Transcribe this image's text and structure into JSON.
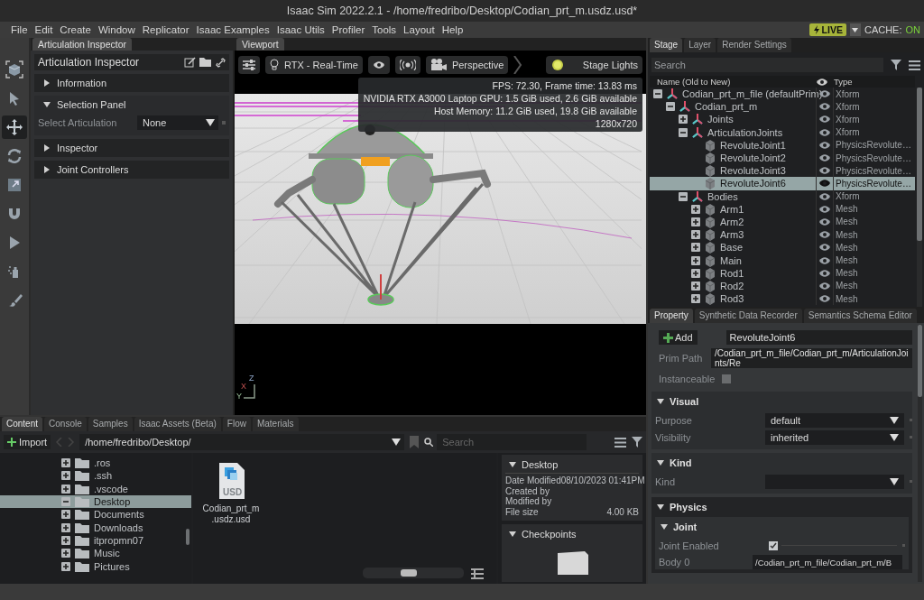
{
  "window": {
    "title": "Isaac Sim 2022.2.1 - /home/fredribo/Desktop/Codian_prt_m.usdz.usd*"
  },
  "menu": [
    "File",
    "Edit",
    "Create",
    "Window",
    "Replicator",
    "Isaac Examples",
    "Isaac Utils",
    "Profiler",
    "Tools",
    "Layout",
    "Help"
  ],
  "live": {
    "label": "LIVE",
    "on": true
  },
  "cache": {
    "label": "CACHE:",
    "status": "ON",
    "on": true
  },
  "toolbar": [
    {
      "kind": "cube",
      "selected": false
    },
    {
      "kind": "pointer",
      "selected": false
    },
    {
      "kind": "move",
      "selected": true
    },
    {
      "kind": "rotate",
      "selected": false
    },
    {
      "kind": "scale",
      "selected": false
    },
    {
      "kind": "magnet",
      "selected": false
    },
    {
      "kind": "play",
      "selected": false
    },
    {
      "kind": "bottle",
      "selected": false
    },
    {
      "kind": "brush",
      "selected": false
    }
  ],
  "articulation_inspector": {
    "tab": "Articulation Inspector",
    "title": "Articulation Inspector",
    "sections": [
      {
        "label": "Information",
        "expanded": false
      },
      {
        "label": "Selection Panel",
        "expanded": true,
        "fields": [
          {
            "label": "Select Articulation",
            "value": "None"
          }
        ]
      },
      {
        "label": "Inspector",
        "expanded": false
      },
      {
        "label": "Joint Controllers",
        "expanded": false
      }
    ]
  },
  "viewport": {
    "tab": "Viewport",
    "renderer": "RTX - Real-Time",
    "camera": "Perspective",
    "lights": "Stage Lights",
    "stats": [
      "FPS: 72.30, Frame time: 13.83 ms",
      "NVIDIA RTX A3000 Laptop GPU: 1.5 GiB used, 2.6 GiB available",
      "Host Memory: 11.2 GiB used, 19.8 GiB available",
      "1280x720"
    ],
    "axes": {
      "z": "Z",
      "x": "X",
      "y": "Y"
    }
  },
  "stage": {
    "tabs": [
      {
        "label": "Stage",
        "selected": true
      },
      {
        "label": "Layer",
        "selected": false
      },
      {
        "label": "Render Settings",
        "selected": false
      }
    ],
    "search": {
      "placeholder": "Search"
    },
    "columns": [
      "Name (Old to New)",
      "Type"
    ],
    "tree": [
      {
        "name": "Codian_prt_m_file (defaultPrim)",
        "type": "Xform",
        "kind": "xform",
        "expanded": true,
        "selected": false,
        "children": [
          {
            "name": "Codian_prt_m",
            "type": "Xform",
            "kind": "xform",
            "expanded": true,
            "selected": false,
            "children": [
              {
                "name": "Joints",
                "type": "Xform",
                "kind": "xform",
                "expanded": false,
                "selected": false
              },
              {
                "name": "ArticulationJoints",
                "type": "Xform",
                "kind": "xform",
                "expanded": true,
                "selected": false,
                "children": [
                  {
                    "name": "RevoluteJoint1",
                    "type": "PhysicsRevolute…",
                    "kind": "prim",
                    "selected": false
                  },
                  {
                    "name": "RevoluteJoint2",
                    "type": "PhysicsRevolute…",
                    "kind": "prim",
                    "selected": false
                  },
                  {
                    "name": "RevoluteJoint3",
                    "type": "PhysicsRevolute…",
                    "kind": "prim",
                    "selected": false
                  },
                  {
                    "name": "RevoluteJoint6",
                    "type": "PhysicsRevolute…",
                    "kind": "prim",
                    "selected": true
                  }
                ]
              },
              {
                "name": "Bodies",
                "type": "Xform",
                "kind": "xform",
                "expanded": true,
                "selected": false,
                "children": [
                  {
                    "name": "Arm1",
                    "type": "Mesh",
                    "kind": "prim",
                    "expanded": false,
                    "selected": false
                  },
                  {
                    "name": "Arm2",
                    "type": "Mesh",
                    "kind": "prim",
                    "expanded": false,
                    "selected": false
                  },
                  {
                    "name": "Arm3",
                    "type": "Mesh",
                    "kind": "prim",
                    "expanded": false,
                    "selected": false
                  },
                  {
                    "name": "Base",
                    "type": "Mesh",
                    "kind": "prim",
                    "expanded": false,
                    "selected": false
                  },
                  {
                    "name": "Main",
                    "type": "Mesh",
                    "kind": "prim",
                    "expanded": false,
                    "selected": false
                  },
                  {
                    "name": "Rod1",
                    "type": "Mesh",
                    "kind": "prim",
                    "expanded": false,
                    "selected": false
                  },
                  {
                    "name": "Rod2",
                    "type": "Mesh",
                    "kind": "prim",
                    "expanded": false,
                    "selected": false
                  },
                  {
                    "name": "Rod3",
                    "type": "Mesh",
                    "kind": "prim",
                    "expanded": false,
                    "selected": false
                  }
                ]
              }
            ]
          }
        ]
      }
    ]
  },
  "property": {
    "tabs": [
      {
        "label": "Property",
        "selected": true
      },
      {
        "label": "Synthetic Data Recorder",
        "selected": false
      },
      {
        "label": "Semantics Schema Editor",
        "selected": false
      }
    ],
    "add_button": "Add",
    "name": "RevoluteJoint6",
    "prim_path": {
      "label": "Prim Path",
      "value": "/Codian_prt_m_file/Codian_prt_m/ArticulationJoints/Re"
    },
    "instanceable": {
      "label": "Instanceable",
      "checked": false
    },
    "sections": [
      {
        "title": "Visual",
        "expanded": true,
        "rows": [
          {
            "kind": "dropdown",
            "label": "Purpose",
            "value": "default"
          },
          {
            "kind": "dropdown",
            "label": "Visibility",
            "value": "inherited"
          }
        ]
      },
      {
        "title": "Kind",
        "expanded": true,
        "rows": [
          {
            "kind": "dropdown",
            "label": "Kind"
          }
        ]
      },
      {
        "title": "Physics",
        "expanded": true,
        "subsections": [
          {
            "title": "Joint",
            "expanded": true,
            "rows": [
              {
                "kind": "checkbox",
                "label": "Joint Enabled",
                "checked": true
              },
              {
                "kind": "text",
                "label": "Body 0",
                "value": "/Codian_prt_m_file/Codian_prt_m/B"
              }
            ]
          }
        ]
      }
    ]
  },
  "content": {
    "tabs": [
      {
        "label": "Content",
        "selected": true
      },
      {
        "label": "Console",
        "selected": false
      },
      {
        "label": "Samples",
        "selected": false
      },
      {
        "label": "Isaac Assets (Beta)",
        "selected": false
      },
      {
        "label": "Flow",
        "selected": false
      },
      {
        "label": "Materials",
        "selected": false
      }
    ],
    "import_button": "Import",
    "path": "/home/fredribo/Desktop/",
    "search": {
      "placeholder": "Search"
    },
    "folders": [
      {
        "name": ".ros",
        "expanded": false,
        "selected": false
      },
      {
        "name": ".ssh",
        "expanded": false,
        "selected": false
      },
      {
        "name": ".vscode",
        "expanded": false,
        "selected": false
      },
      {
        "name": "Desktop",
        "expanded": true,
        "selected": true
      },
      {
        "name": "Documents",
        "expanded": false,
        "selected": false
      },
      {
        "name": "Downloads",
        "expanded": false,
        "selected": false
      },
      {
        "name": "itpropmn07",
        "expanded": false,
        "selected": false
      },
      {
        "name": "Music",
        "expanded": false,
        "selected": false
      },
      {
        "name": "Pictures",
        "expanded": false,
        "selected": false
      }
    ],
    "files": [
      {
        "name": [
          "Codian_prt_m",
          ".usdz.usd"
        ],
        "icon_text": "USD"
      }
    ],
    "zoom": {
      "level": 0.45
    },
    "details": {
      "title": "Desktop",
      "rows": [
        {
          "label": "Date Modified",
          "value": "08/10/2023 01:41PM"
        },
        {
          "label": "Created by"
        },
        {
          "label": "Modified by"
        },
        {
          "label": "File size",
          "value": "4.00 KB"
        }
      ],
      "checkpoints": "Checkpoints"
    }
  }
}
